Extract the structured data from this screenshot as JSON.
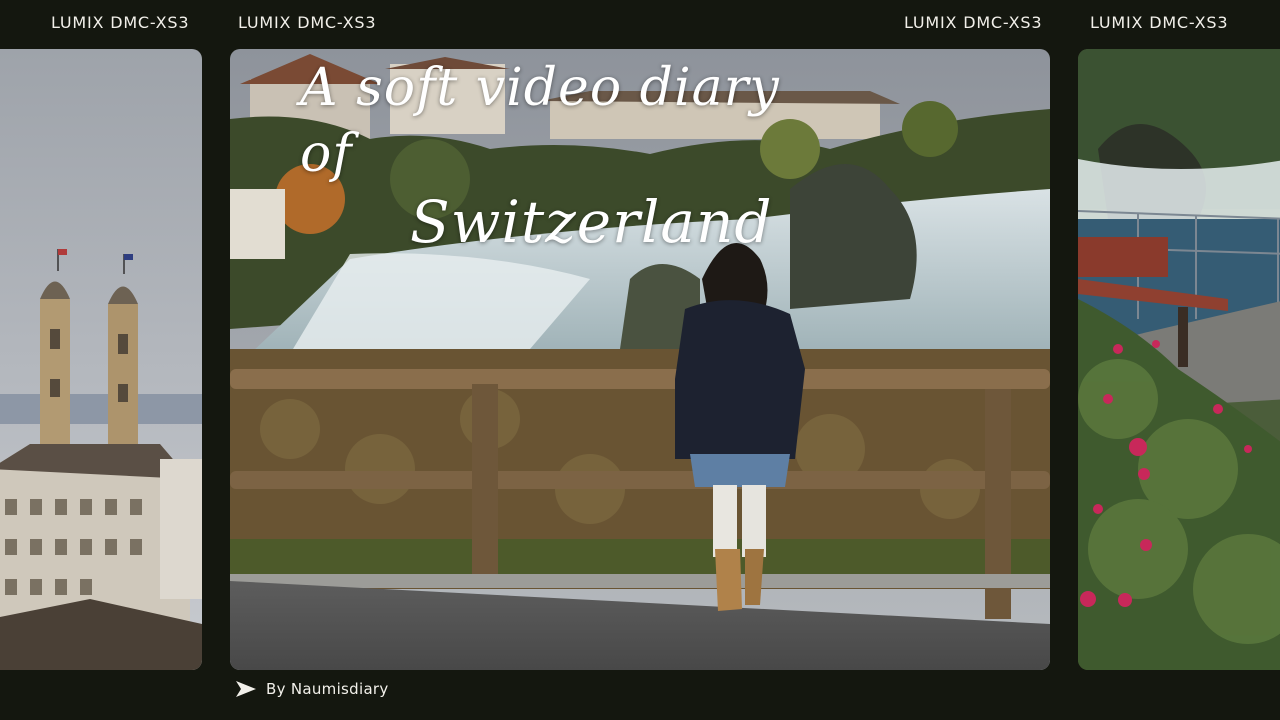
{
  "labels": {
    "top_left": "LUMIX DMC-XS3",
    "top_center_left": "LUMIX DMC-XS3",
    "top_center_right": "LUMIX DMC-XS3",
    "top_right": "LUMIX DMC-XS3"
  },
  "title": {
    "line1": "A soft video diary of",
    "line2": "Switzerland"
  },
  "byline": {
    "icon": "send-arrow-icon",
    "text": "By Naumisdiary"
  },
  "colors": {
    "background": "#14170f",
    "text": "#f2f0ea"
  }
}
